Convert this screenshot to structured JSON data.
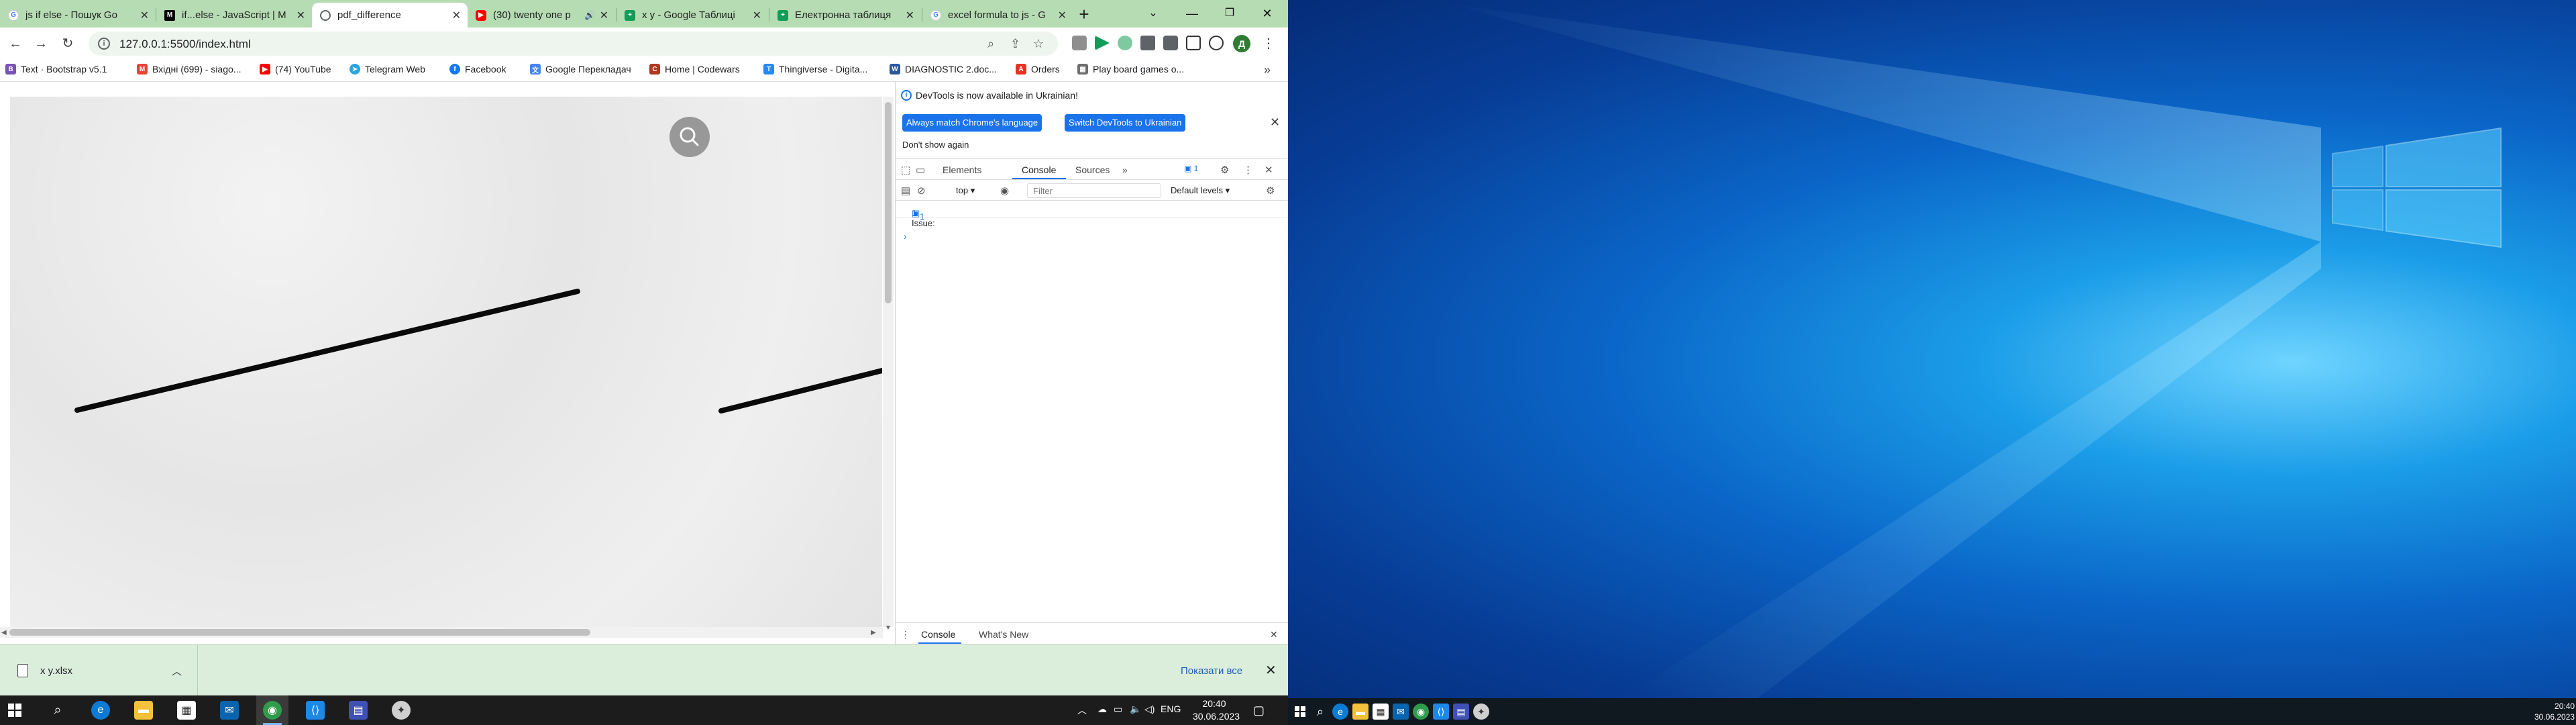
{
  "browser": {
    "tabs": [
      {
        "label": "js if else - Пошук Go",
        "favicon": "google-icon",
        "active": false
      },
      {
        "label": "if...else - JavaScript | M",
        "favicon": "mdn-icon",
        "active": false
      },
      {
        "label": "pdf_difference",
        "favicon": "globe-icon",
        "active": true
      },
      {
        "label": "(30) twenty one p",
        "favicon": "youtube-icon",
        "active": false
      },
      {
        "label": "x y - Google Таблиці",
        "favicon": "sheets-icon",
        "active": false
      },
      {
        "label": "Електронна таблиця",
        "favicon": "sheets-icon",
        "active": false
      },
      {
        "label": "excel formula to js - G",
        "favicon": "google-icon",
        "active": false
      }
    ],
    "new_tab": "+",
    "window_controls": {
      "minimize": "—",
      "maximize": "❐",
      "close": "✕",
      "tab_list": "⌄"
    },
    "nav": {
      "back": "←",
      "forward": "→",
      "reload": "↻"
    },
    "address": "127.0.0.1:5500/index.html",
    "profile_initial": "Д",
    "bookmarks": [
      {
        "label": "Text · Bootstrap v5.1",
        "icon": "bootstrap-icon",
        "color": "#7952b3"
      },
      {
        "label": "Вхідні (699) - siago...",
        "icon": "gmail-icon",
        "color": "#ea4335"
      },
      {
        "label": "(74) YouTube",
        "icon": "youtube-icon",
        "color": "#ff0000"
      },
      {
        "label": "Telegram Web",
        "icon": "telegram-icon",
        "color": "#2aa3df"
      },
      {
        "label": "Facebook",
        "icon": "facebook-icon",
        "color": "#1877f2"
      },
      {
        "label": "Google Перекладач",
        "icon": "translate-icon",
        "color": "#4285f4"
      },
      {
        "label": "Home | Codewars",
        "icon": "codewars-icon",
        "color": "#b1361e"
      },
      {
        "label": "Thingiverse - Digita...",
        "icon": "thingiverse-icon",
        "color": "#248bfb"
      },
      {
        "label": "DIAGNOSTIC 2.doc...",
        "icon": "word-icon",
        "color": "#2b579a"
      },
      {
        "label": "Orders",
        "icon": "aliexpress-icon",
        "color": "#e43225"
      },
      {
        "label": "Play board games o...",
        "icon": "boardgame-icon",
        "color": "#6d6d6d"
      }
    ],
    "bookmarks_more": "»"
  },
  "devtools": {
    "info_message": "DevTools is now available in Ukrainian!",
    "btn_match": "Always match Chrome's language",
    "btn_switch": "Switch DevTools to Ukrainian",
    "dont_show": "Don't show again",
    "tabs": [
      "Elements",
      "Console",
      "Sources"
    ],
    "more_tabs": "»",
    "issue_count": "1",
    "context": "top",
    "filter_placeholder": "Filter",
    "levels": "Default levels",
    "issues_text": "1 Issue:",
    "issues_count": "1",
    "prompt": "›",
    "drawer_tabs": [
      "Console",
      "What's New"
    ]
  },
  "downloads": {
    "file": "x y.xlsx",
    "show_all": "Показати все"
  },
  "taskbar": {
    "lang": "ENG",
    "time": "20:40",
    "date": "30.06.2023"
  },
  "taskbar2": {
    "time": "20:40",
    "date": "30.06.2023"
  }
}
